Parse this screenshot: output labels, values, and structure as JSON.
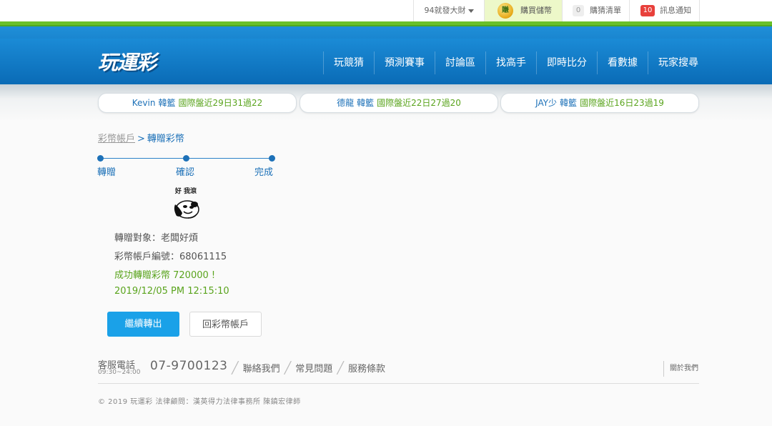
{
  "topbar": {
    "user_name": "94就發大財",
    "buy_coin_icon_text": "賺",
    "buy_label": "購買儲幣",
    "cart_count": "0",
    "cart_label": "購猜清單",
    "msg_count": "10",
    "msg_label": "訊息通知"
  },
  "header": {
    "logo": "玩運彩",
    "nav": [
      "玩競猜",
      "預測賽事",
      "討論區",
      "找高手",
      "即時比分",
      "看數據",
      "玩家搜尋"
    ]
  },
  "tickers": [
    {
      "name": "Kevin",
      "sport": "韓籃",
      "record": "國際盤近29日31過22"
    },
    {
      "name": "德龍",
      "sport": "韓籃",
      "record": "國際盤近22日27過20"
    },
    {
      "name": "JAY少",
      "sport": "韓籃",
      "record": "國際盤近16日23過19"
    }
  ],
  "breadcrumb": {
    "parent": "彩幣帳戶",
    "separator": ">",
    "current": "轉贈彩幣"
  },
  "steps": [
    "轉贈",
    "確認",
    "完成"
  ],
  "avatar": {
    "text": "好 我滾",
    "icon": "panda-meme-icon"
  },
  "result": {
    "target": "轉贈對象：老闆好煩",
    "account": "彩幣帳戶編號：68061115",
    "success": "成功轉贈彩幣 720000 !",
    "datetime": "2019/12/05 PM 12:15:10"
  },
  "buttons": {
    "continue": "繼續轉出",
    "back": "回彩幣帳戶"
  },
  "footer": {
    "cs_label": "客服電話",
    "cs_hours": "09:30~24:00",
    "phone": "07-9700123",
    "links": [
      "聯絡我們",
      "常見問題",
      "服務條款"
    ],
    "about": "關於我們",
    "copyright": "© 2019 玩運彩 法律顧問：漢英得力法律事務所 陳鎮宏律師"
  },
  "colors": {
    "primary": "#1aa1e8",
    "accent_blue": "#1d71b8",
    "success_green": "#5aa41d",
    "alert_red": "#e8403b"
  }
}
